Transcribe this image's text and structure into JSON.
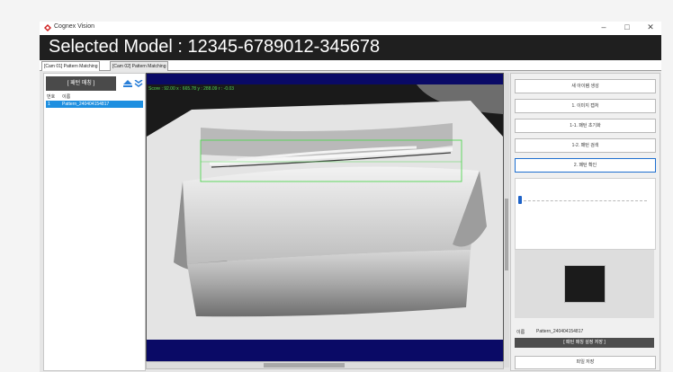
{
  "window": {
    "app_title": "Cognex Vision",
    "controls": {
      "minimize": "–",
      "maximize": "□",
      "close": "✕"
    },
    "brand_color": "#d02020"
  },
  "header": {
    "title": "Selected Model : 12345-6789012-345678"
  },
  "tabs": [
    {
      "label": "[Cam 01] Pattern Matching",
      "active": true
    },
    {
      "label": "[Cam 02] Pattern Matching",
      "active": false
    }
  ],
  "left_panel": {
    "title": "[ 패턴 매칭 ]",
    "icons": [
      "eject-icon",
      "chevron-double-down-icon"
    ],
    "columns": [
      "번호",
      "이름"
    ],
    "rows": [
      {
        "no": "1",
        "name": "Pattern_240404154817"
      }
    ],
    "selected_color": "#1e8fe0"
  },
  "viewer": {
    "score_text": "Score : 92.00  x : 665.78  y : 288.09  r : -0.03",
    "overlay_color": "#52d652",
    "background": "#0a0a66"
  },
  "right_panel": {
    "buttons": [
      {
        "label": "새 아이템 생성",
        "active": false
      },
      {
        "label": "1. 이미지 캡처",
        "active": false
      },
      {
        "label": "1-1. 패턴 초기화",
        "active": false
      },
      {
        "label": "1-2. 패턴 검색",
        "active": false
      },
      {
        "label": "2. 패턴 확인",
        "active": true
      }
    ],
    "slider": {
      "value": 0.0
    },
    "name_label": "이름",
    "name_value": "Pattern_240404154817",
    "settings_save_label": "[ 패턴 매칭 설정 저장 ]",
    "file_save_label": "파일 저장"
  }
}
